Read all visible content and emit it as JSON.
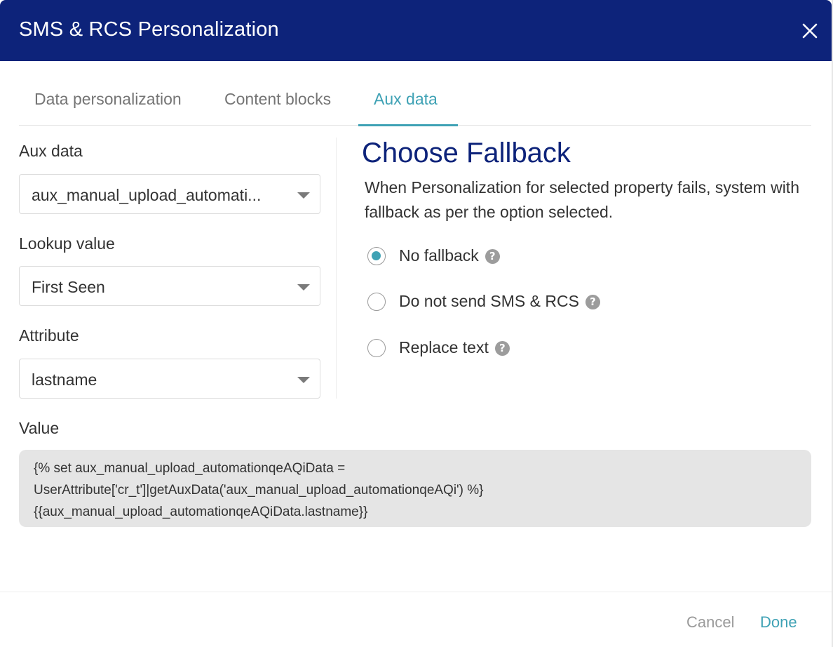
{
  "header": {
    "title": "SMS & RCS Personalization",
    "close_icon": "close-icon"
  },
  "tabs": [
    {
      "label": "Data personalization",
      "active": false
    },
    {
      "label": "Content blocks",
      "active": false
    },
    {
      "label": "Aux data",
      "active": true
    }
  ],
  "form": {
    "aux_data": {
      "label": "Aux data",
      "value": "aux_manual_upload_automati..."
    },
    "lookup_value": {
      "label": "Lookup value",
      "value": "First Seen"
    },
    "attribute": {
      "label": "Attribute",
      "value": "lastname"
    }
  },
  "fallback": {
    "title": "Choose Fallback",
    "description": "When Personalization for selected property fails, system with fallback as per the option selected.",
    "options": [
      {
        "label": "No fallback",
        "checked": true
      },
      {
        "label": "Do not send SMS & RCS",
        "checked": false
      },
      {
        "label": "Replace text",
        "checked": false
      }
    ],
    "help_glyph": "?"
  },
  "value": {
    "label": "Value",
    "lines": [
      "{% set aux_manual_upload_automationqeAQiData =",
      "UserAttribute['cr_t']|getAuxData('aux_manual_upload_automationqeAQi') %}",
      "{{aux_manual_upload_automationqeAQiData.lastname}}"
    ]
  },
  "footer": {
    "cancel_label": "Cancel",
    "done_label": "Done"
  },
  "colors": {
    "header_bg": "#0d237a",
    "accent": "#3fa2b5",
    "title_blue": "#0d237a",
    "value_bg": "#e5e5e5"
  }
}
